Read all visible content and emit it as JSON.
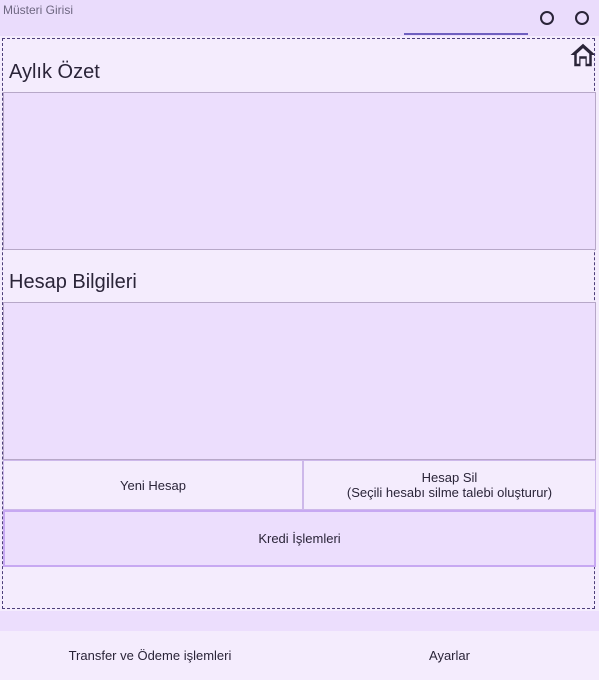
{
  "window": {
    "title": "Müsteri Girisi"
  },
  "header": {
    "buttons": [
      "circle-button-1",
      "circle-button-2"
    ]
  },
  "sections": {
    "monthly_summary": {
      "title": "Aylık Özet"
    },
    "account_info": {
      "title": "Hesap Bilgileri"
    }
  },
  "actions": {
    "new_account": "Yeni Hesap",
    "delete_account": "Hesap Sil",
    "delete_account_hint": "(Seçili hesabı silme talebi oluşturur)",
    "credit_operations": "Kredi İşlemleri"
  },
  "bottom_nav": {
    "transfer_payments": "Transfer ve Ödeme işlemleri",
    "settings": "Ayarlar"
  },
  "icons": {
    "home": "home-icon"
  },
  "colors": {
    "background": "#f4ecfd",
    "panel": "#ecdefd",
    "accent": "#6f5fbf",
    "text": "#2a2438"
  }
}
